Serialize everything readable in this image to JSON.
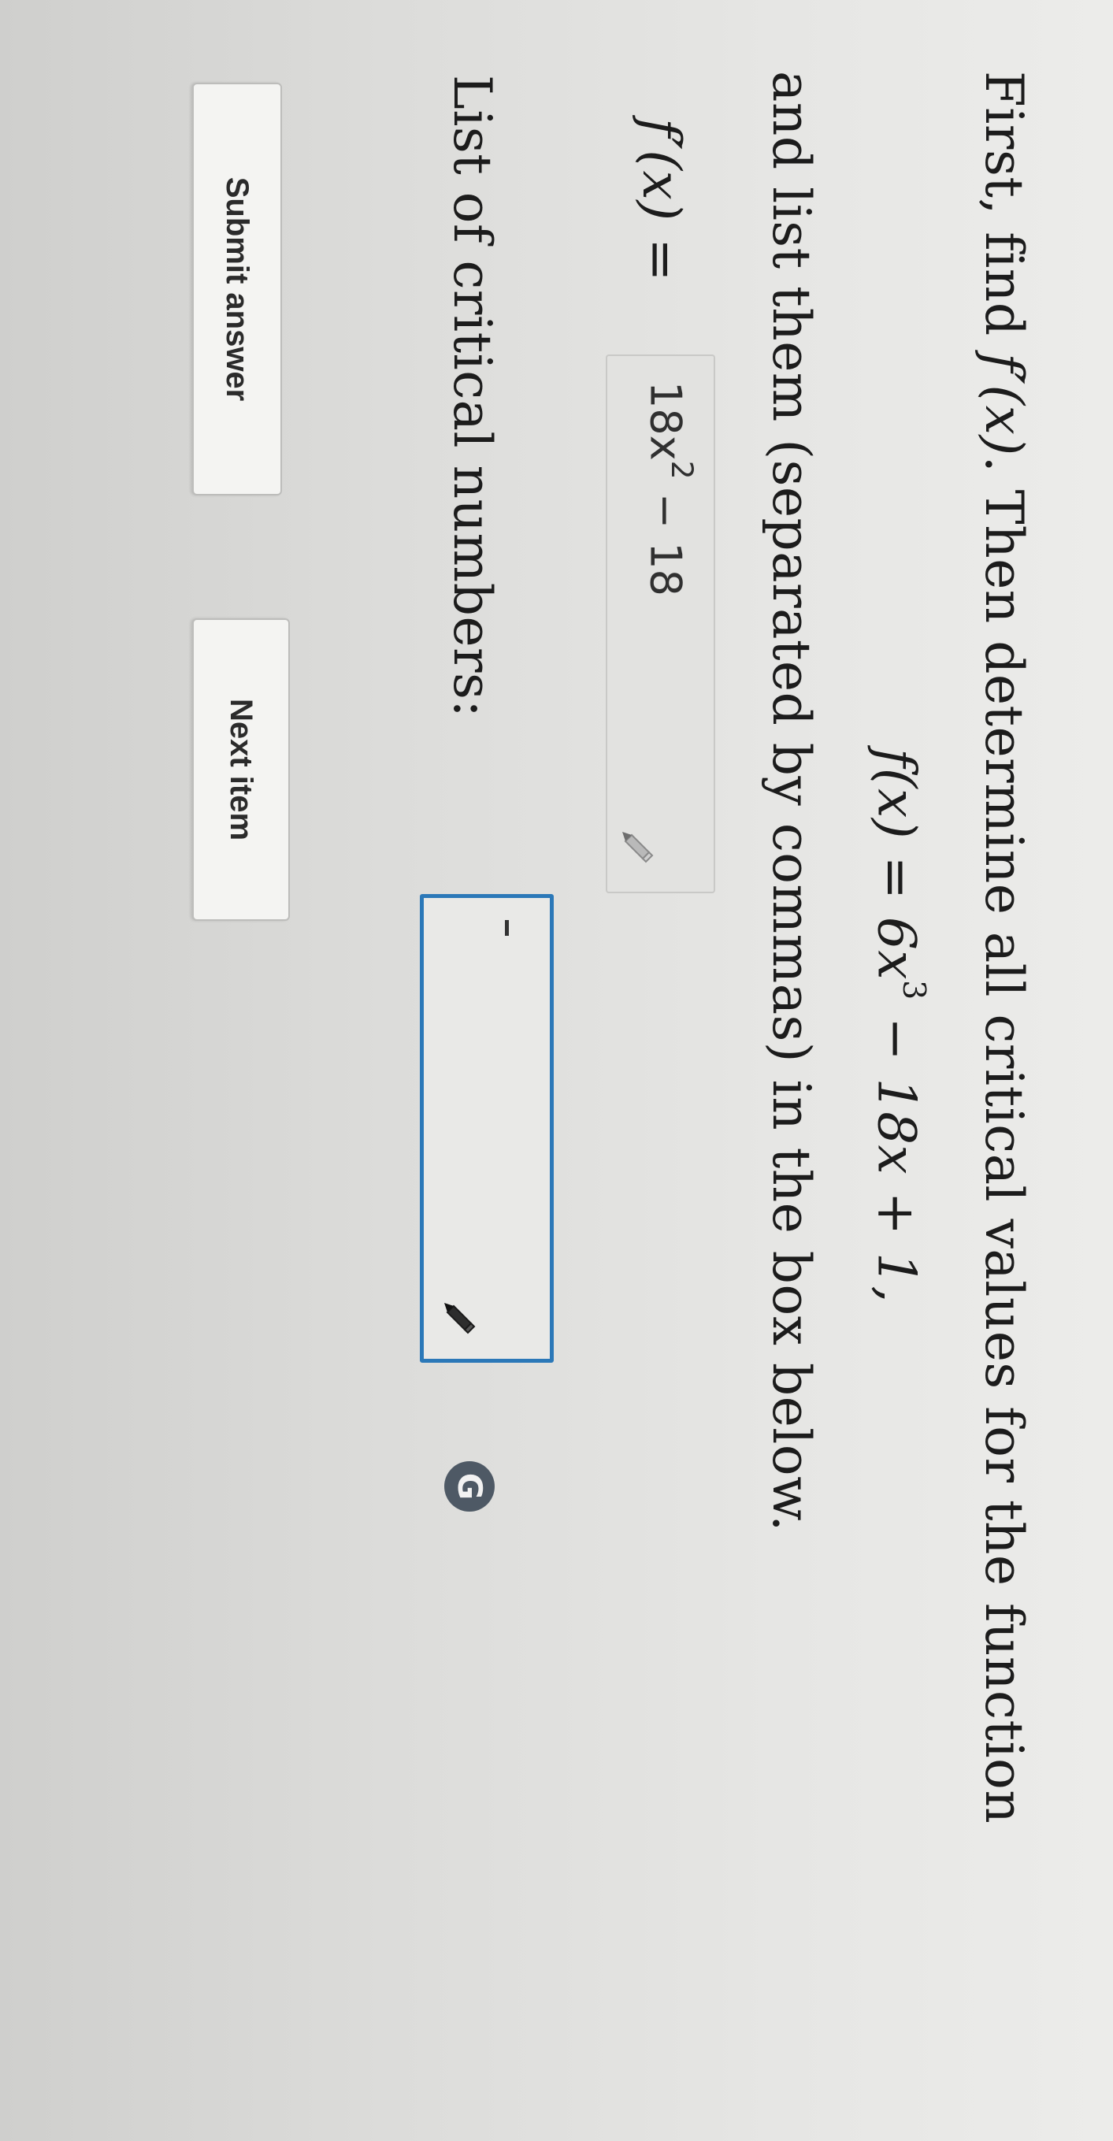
{
  "question": {
    "intro_line": {
      "before_math": "First, find ",
      "math": "f′(x)",
      "after_math": ". Then determine all critical values for the function"
    },
    "function_display": {
      "lhs": "f(x) = 6x",
      "exponent": "3",
      "rhs": " − 18x + 1,"
    },
    "instruction_line": "and list them (separated by commas) in the box below."
  },
  "derivative_field": {
    "label": "f′(x) =",
    "value_base": "18x",
    "value_exponent": "2",
    "value_tail": " − 18"
  },
  "critical_numbers_field": {
    "label": "List of critical numbers:",
    "value": ""
  },
  "badge": {
    "letter": "G"
  },
  "buttons": {
    "submit_label": "Submit answer",
    "next_label": "Next item"
  },
  "colors": {
    "active_border": "#2b78b8",
    "badge_bg": "#4e5965"
  }
}
